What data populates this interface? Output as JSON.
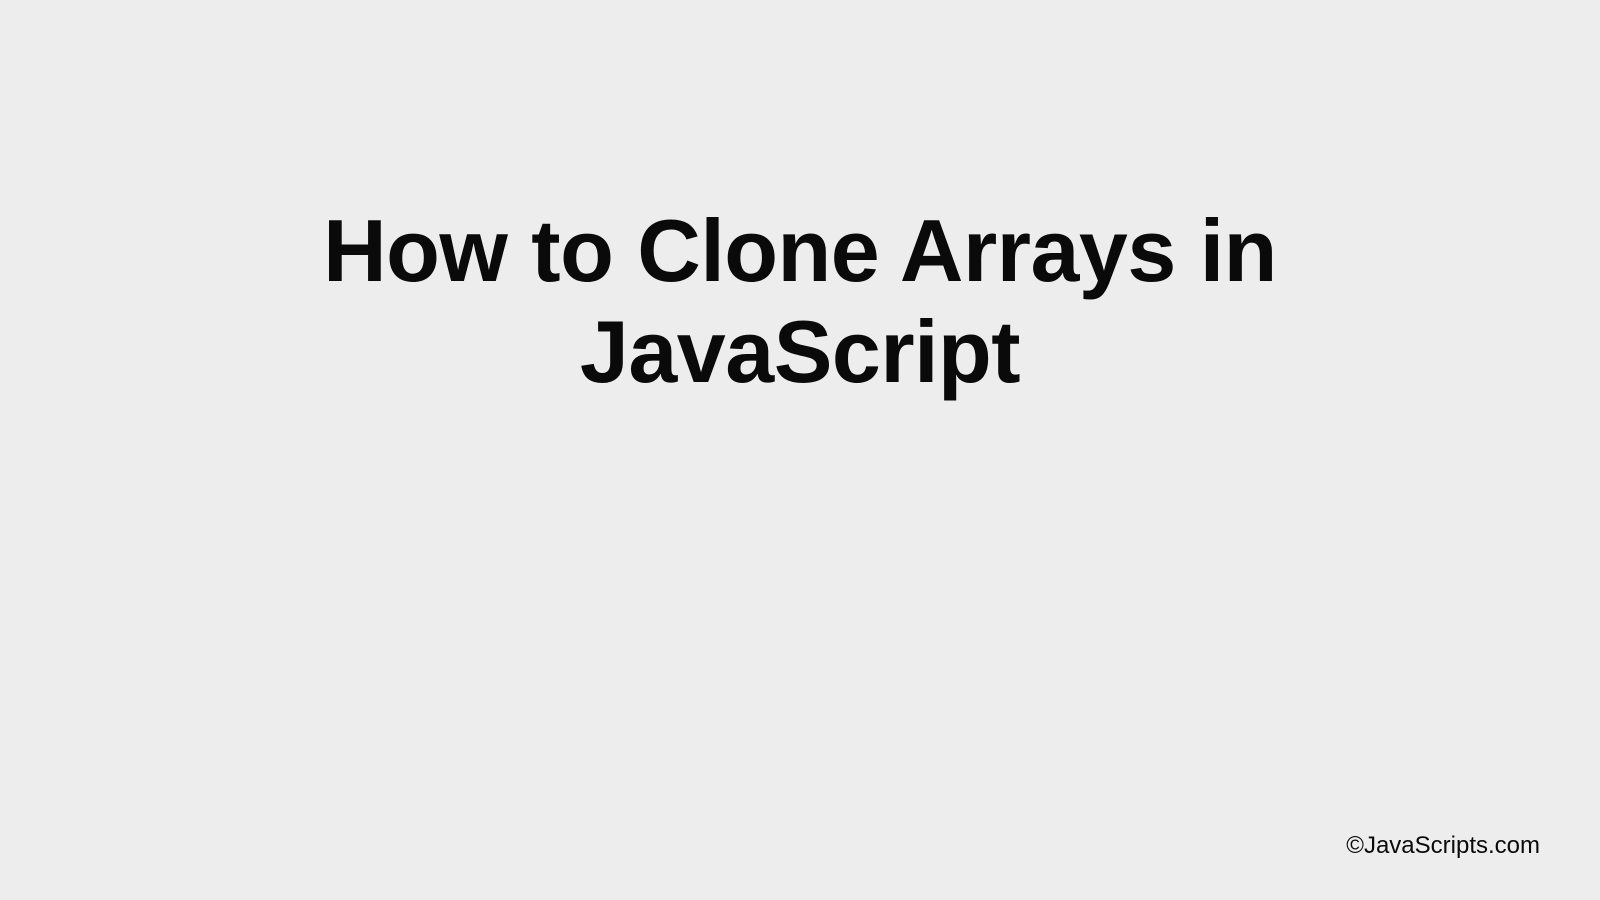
{
  "slide": {
    "title": "How to Clone Arrays in JavaScript",
    "footer": "©JavaScripts.com"
  }
}
